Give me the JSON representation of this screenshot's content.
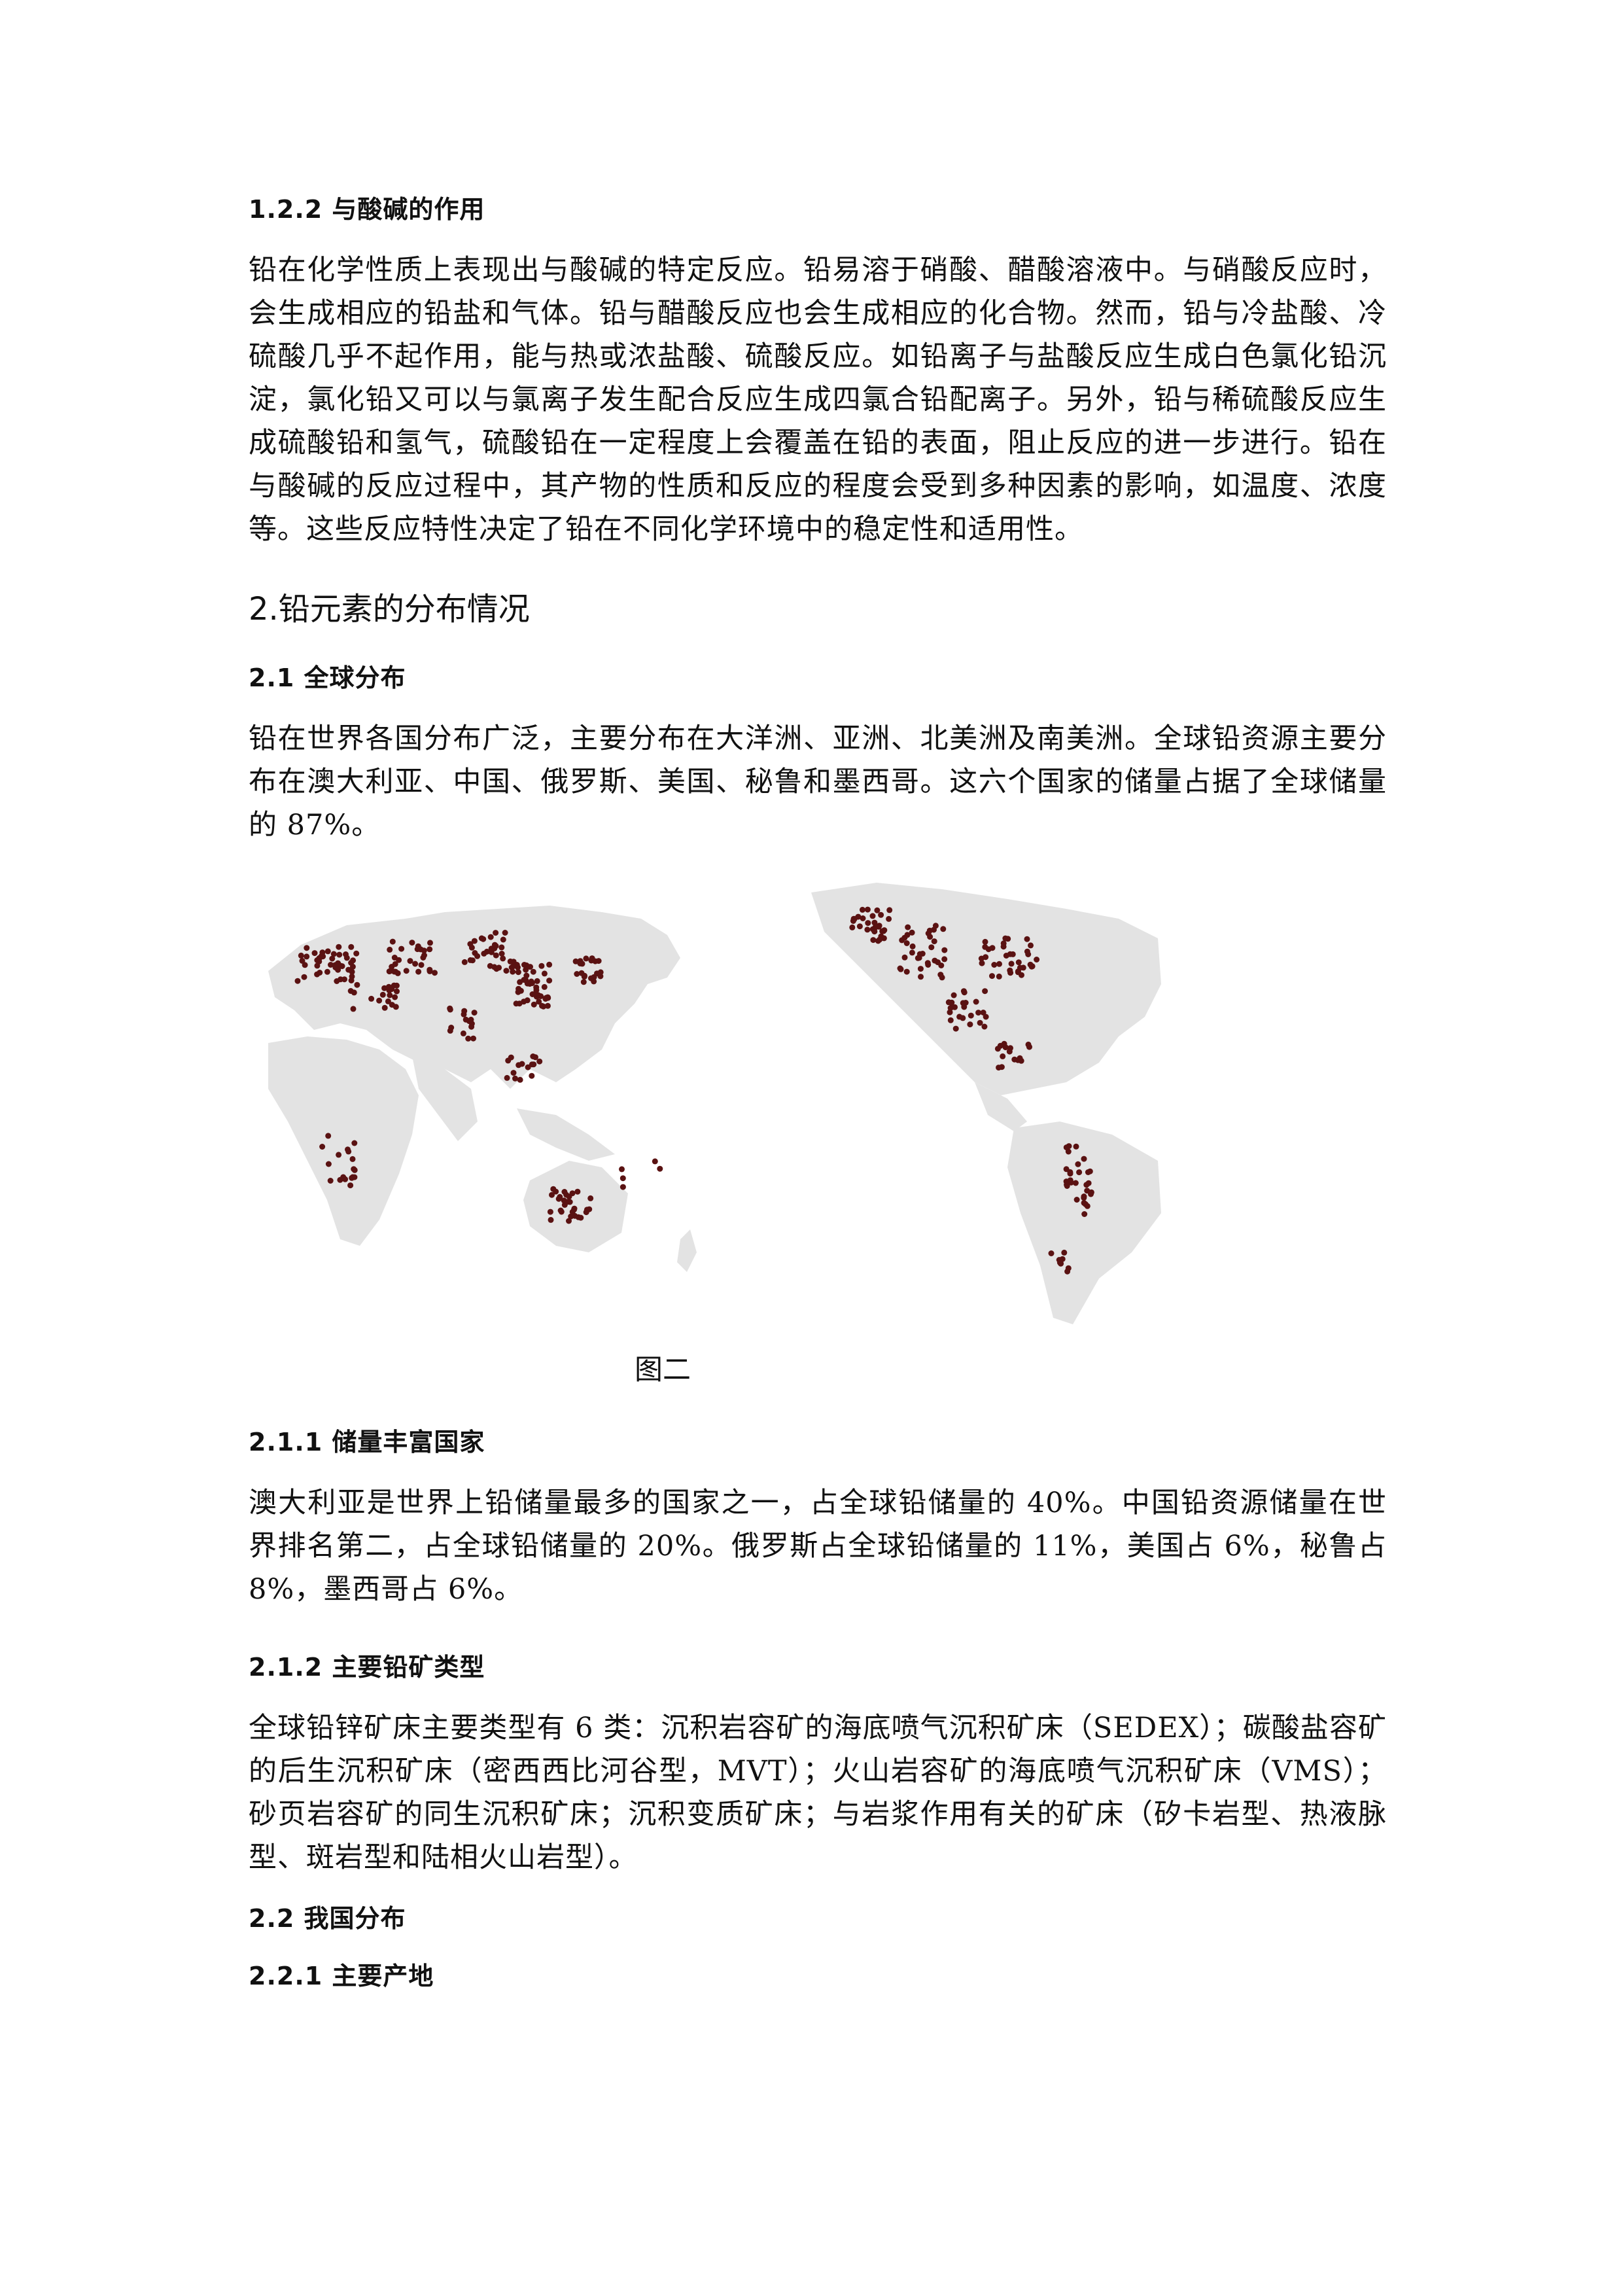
{
  "s122": {
    "heading": "1.2.2 与酸碱的作用",
    "body": "铅在化学性质上表现出与酸碱的特定反应。铅易溶于硝酸、醋酸溶液中。与硝酸反应时，会生成相应的铅盐和气体。铅与醋酸反应也会生成相应的化合物。然而，铅与冷盐酸、冷硫酸几乎不起作用，能与热或浓盐酸、硫酸反应。如铅离子与盐酸反应生成白色氯化铅沉淀，氯化铅又可以与氯离子发生配合反应生成四氯合铅配离子。另外，铅与稀硫酸反应生成硫酸铅和氢气，硫酸铅在一定程度上会覆盖在铅的表面，阻止反应的进一步进行。铅在与酸碱的反应过程中，其产物的性质和反应的程度会受到多种因素的影响，如温度、浓度等。这些反应特性决定了铅在不同化学环境中的稳定性和适用性。"
  },
  "s2": {
    "heading": "2.铅元素的分布情况"
  },
  "s21": {
    "heading": "2.1 全球分布",
    "body": "铅在世界各国分布广泛，主要分布在大洋洲、亚洲、北美洲及南美洲。全球铅资源主要分布在澳大利亚、中国、俄罗斯、美国、秘鲁和墨西哥。这六个国家的储量占据了全球储量的 87%。"
  },
  "figure": {
    "caption": "图二",
    "land_color": "#e3e3e3",
    "dot_color": "#5a1212"
  },
  "s211": {
    "heading": "2.1.1 储量丰富国家",
    "body": "澳大利亚是世界上铅储量最多的国家之一，占全球铅储量的 40%。中国铅资源储量在世界排名第二，占全球铅储量的 20%。俄罗斯占全球铅储量的 11%，美国占 6%，秘鲁占 8%，墨西哥占 6%。"
  },
  "s212": {
    "heading": "2.1.2 主要铅矿类型",
    "body": "全球铅锌矿床主要类型有 6 类：沉积岩容矿的海底喷气沉积矿床（SEDEX）；碳酸盐容矿的后生沉积矿床（密西西比河谷型，MVT）；火山岩容矿的海底喷气沉积矿床（VMS）；砂页岩容矿的同生沉积矿床；沉积变质矿床；与岩浆作用有关的矿床（矽卡岩型、热液脉型、斑岩型和陆相火山岩型）。"
  },
  "s22": {
    "heading": "2.2 我国分布"
  },
  "s221": {
    "heading": "2.2.1 主要产地"
  }
}
